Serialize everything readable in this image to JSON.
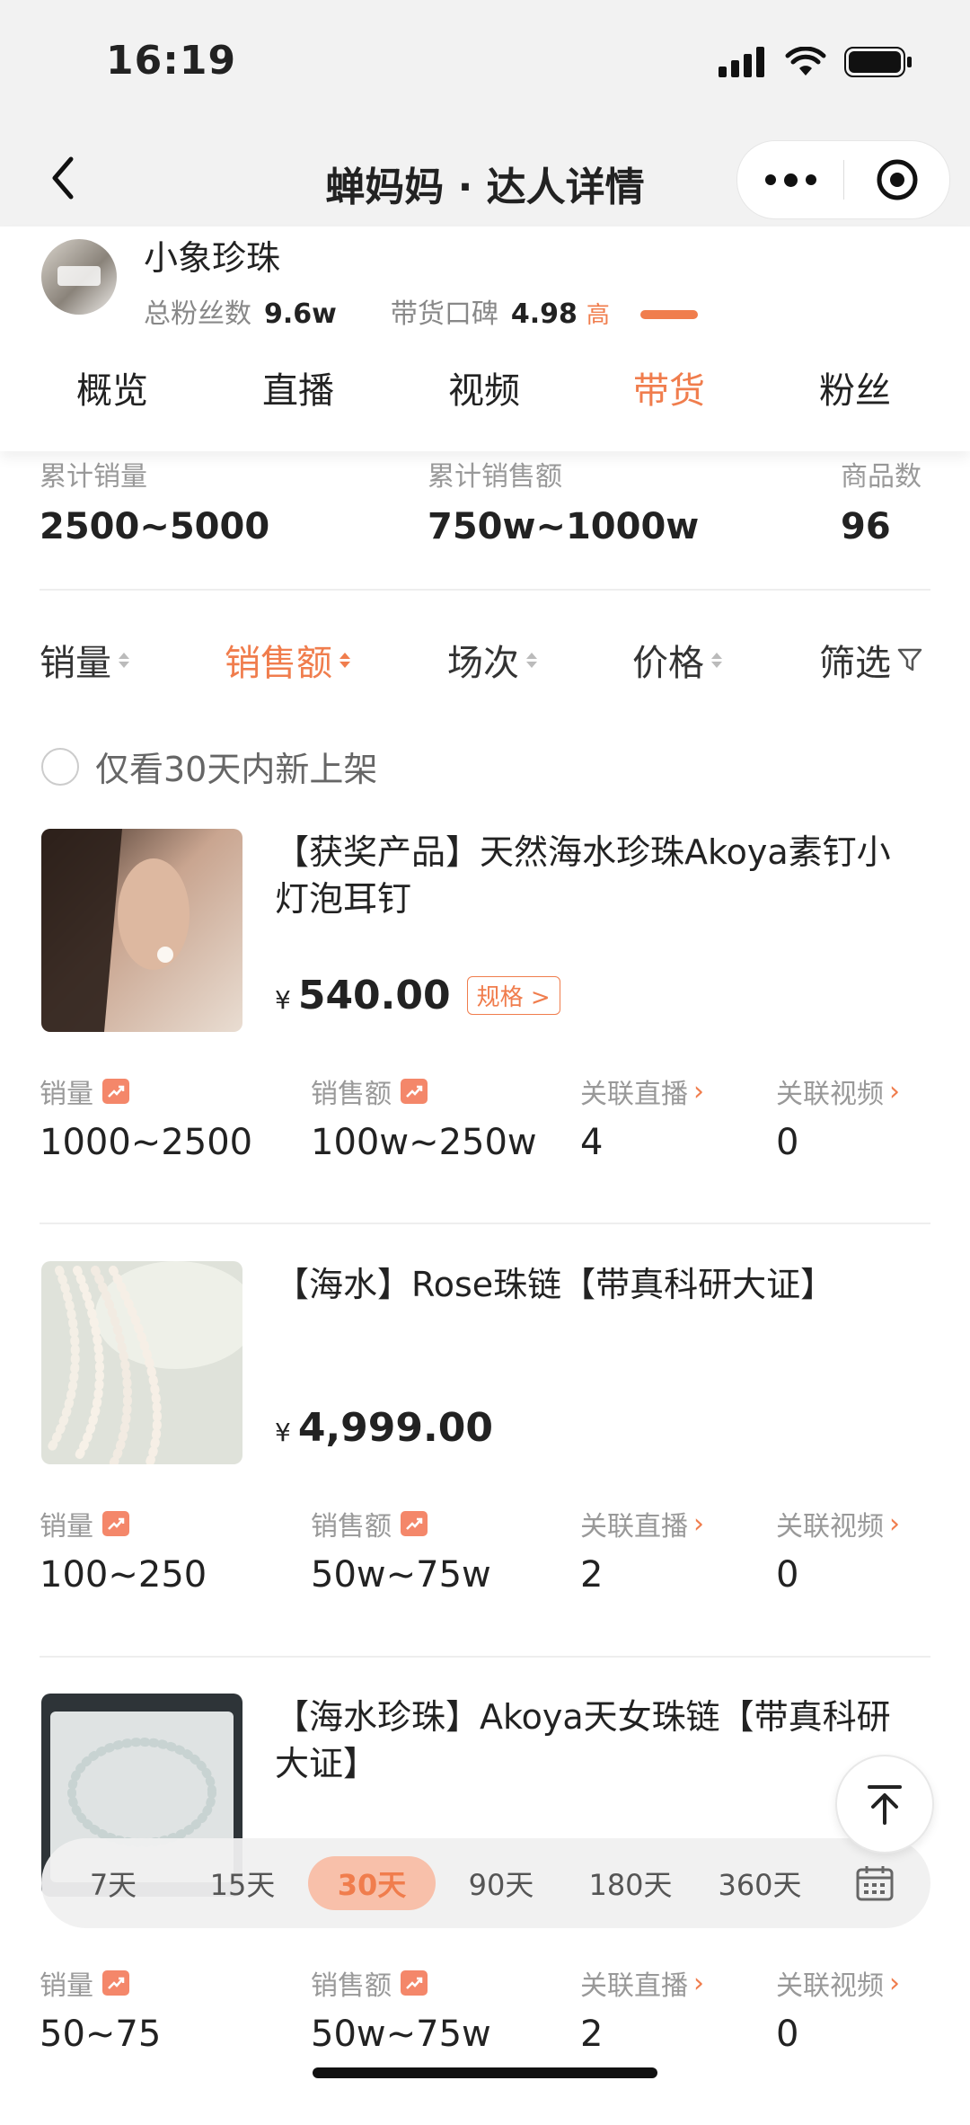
{
  "status_bar": {
    "time": "16:19"
  },
  "nav": {
    "title": "蝉妈妈 · 达人详情"
  },
  "profile": {
    "name": "小象珍珠",
    "fans_label": "总粉丝数",
    "fans_value": "9.6w",
    "rating_label": "带货口碑",
    "rating_value": "4.98",
    "rating_level": "高"
  },
  "tabs": [
    "概览",
    "直播",
    "视频",
    "带货",
    "粉丝"
  ],
  "active_tab": "带货",
  "summary": [
    {
      "label": "累计销量",
      "value": "2500~5000"
    },
    {
      "label": "累计销售额",
      "value": "750w~1000w"
    },
    {
      "label": "商品数",
      "value": "96"
    }
  ],
  "sort_options": [
    "销量",
    "销售额",
    "场次",
    "价格"
  ],
  "filter_label": "筛选",
  "active_sort": "销售额",
  "new_only_label": "仅看30天内新上架",
  "metric_labels": {
    "sales": "销量",
    "revenue": "销售额",
    "live": "关联直播",
    "video": "关联视频"
  },
  "products": [
    {
      "name": "【获奖产品】天然海水珍珠Akoya素钉小灯泡耳钉",
      "currency": "¥",
      "price": "540.00",
      "spec_label": "规格 >",
      "sales": "1000~2500",
      "revenue": "100w~250w",
      "live": "4",
      "video": "0"
    },
    {
      "name": "【海水】Rose珠链【带真科研大证】",
      "currency": "¥",
      "price": "4,999.00",
      "sales": "100~250",
      "revenue": "50w~75w",
      "live": "2",
      "video": "0"
    },
    {
      "name": "【海水珍珠】Akoya天女珠链【带真科研大证】",
      "sales": "50~75",
      "revenue": "50w~75w",
      "live": "2",
      "video": "0"
    }
  ],
  "ranges": [
    "7天",
    "15天",
    "30天",
    "90天",
    "180天",
    "360天"
  ],
  "active_range": "30天",
  "colors": {
    "accent": "#f07d4d",
    "muted": "#999999"
  }
}
